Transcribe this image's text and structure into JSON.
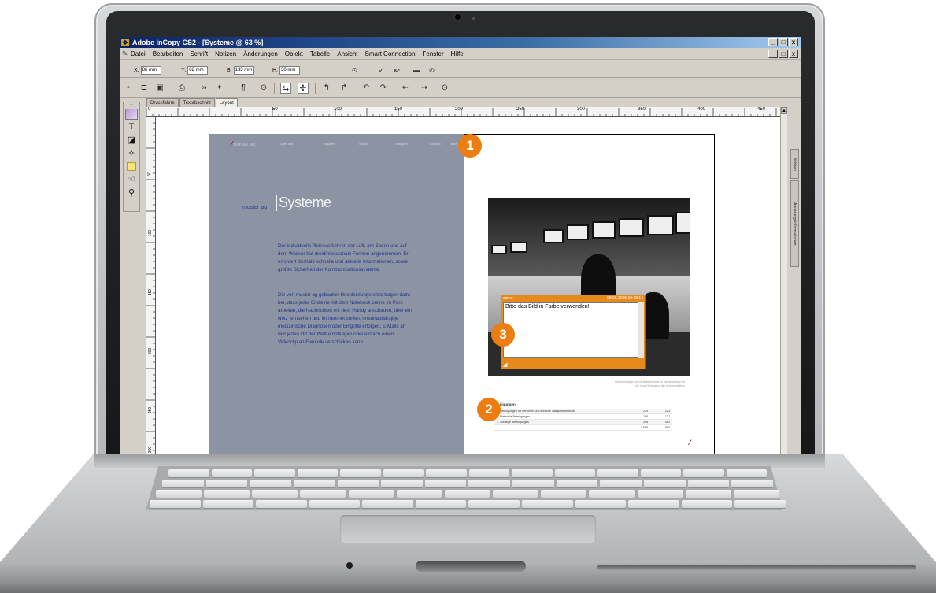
{
  "window": {
    "title": "Adobe InCopy CS2 - [Systeme @ 63 %]",
    "controls": [
      "_",
      "□",
      "x"
    ],
    "doc_controls": [
      "_",
      "□",
      "x"
    ]
  },
  "menu": [
    "Datei",
    "Bearbeiten",
    "Schrift",
    "Notizen",
    "Änderungen",
    "Objekt",
    "Tabelle",
    "Ansicht",
    "Smart Connection",
    "Fenster",
    "Hilfe"
  ],
  "control_bar": {
    "fields": [
      {
        "label": "X:",
        "value": "86 mm"
      },
      {
        "label": "Y:",
        "value": "82 mm"
      },
      {
        "label": "B:",
        "value": "133 mm"
      },
      {
        "label": "H:",
        "value": "30 mm"
      }
    ]
  },
  "tabs": [
    "Druckfahne",
    "Textabschnitt",
    "Layout"
  ],
  "active_tab": "Layout",
  "ruler_h_labels": [
    "0",
    "50",
    "100",
    "150",
    "200",
    "250",
    "300",
    "350",
    "400",
    "450"
  ],
  "ruler_v_labels": [
    "50",
    "100",
    "150",
    "200",
    "250",
    "300"
  ],
  "left_page": {
    "nav": {
      "logo_text": "muster ag",
      "items": [
        "Über uns",
        "Systeme",
        "Studio",
        "Transport",
        "Kontakt",
        "News"
      ]
    },
    "company": "muster ag",
    "heading": "Systeme",
    "paragraphs": [
      "Der individuelle Reiseverkehr in der Luft, am Boden und auf dem Wasser hat dreidimensionale Formen angenommen. Er erfordert deshalb schnelle und aktuelle Informationen, sowie größte Sicherheit der Kommunikationssysteme.",
      "Die von muster ag gebauten Hochleistungsnetze tragen dazu bei, dass jeder Einzelne mit dem Notebook online im Park arbeiten, die Nachrichten mit dem Handy anschauen, über ein Netz fernsehen und im Internet surfen, ortsunabhängige medizinische Diagnosen oder Eingriffe erfolgen, E-Mails an fast jeden Ort der Welt empfangen oder einfach einen Videoclip an Freunde verschicken kann."
    ]
  },
  "right_page": {
    "note": {
      "author": "sarno",
      "timestamp": "08.06.2005 10:48:14",
      "text": "Bitte das Bild in Farbe verwenden!"
    },
    "caption": "Firmenvorlagen und Arbeitsbereiche im Mediendesign für die neue Generation der Kommunikation",
    "table_title": "Beteiligungen",
    "table_rows": [
      {
        "label": "1. Beteiligungen für Personen und ähnliche Tätigkeitsbereiche",
        "a": "279",
        "b": "223"
      },
      {
        "label": "2. Materielle Beteiligungen",
        "a": "188",
        "b": "177"
      },
      {
        "label": "3. Sonstige Beteiligungen",
        "a": "298",
        "b": "403"
      },
      {
        "label": "",
        "a": "5.665",
        "b": "883"
      }
    ]
  },
  "side_tabs": [
    "Änderungsinformationen",
    "Notizen"
  ],
  "callouts": [
    "1",
    "2",
    "3"
  ],
  "colors": {
    "callout": "#ee7d10",
    "left_page": "#8c93a3",
    "body_text": "#23378c",
    "note": "#e68a1c",
    "titlebar": "#0a246a"
  },
  "icons": {
    "toolbar": [
      "new-document-icon",
      "open-icon",
      "save-icon",
      "print-icon",
      "find-icon",
      "spellcheck-icon",
      "pilcrow-icon",
      "target-icon",
      "track-changes-icon",
      "accept-change-icon",
      "reject-change-icon",
      "note-icon",
      "history-icon"
    ],
    "tools": [
      "type-tool-icon",
      "note-tool-icon",
      "position-tool-icon",
      "color-swatch-icon",
      "hand-tool-icon",
      "zoom-tool-icon"
    ]
  }
}
